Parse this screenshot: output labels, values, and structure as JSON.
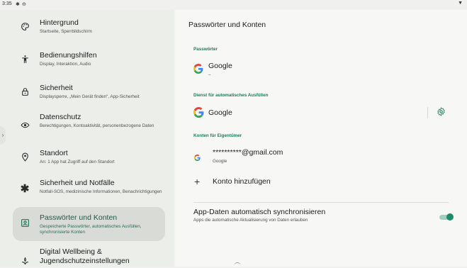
{
  "status": {
    "time": "3:35"
  },
  "sidebar": {
    "items": [
      {
        "title": "Hintergrund",
        "subtitle": "Startseite, Sperrbildschirm"
      },
      {
        "title": "Bedienungshilfen",
        "subtitle": "Display, Interaktion, Audio"
      },
      {
        "title": "Sicherheit",
        "subtitle": "Displaysperre, „Mein Gerät finden“, App-Sicherheit"
      },
      {
        "title": "Datenschutz",
        "subtitle": "Berechtigungen, Kontoaktivität, personenbezogene Daten"
      },
      {
        "title": "Standort",
        "subtitle": "An: 1 App hat Zugriff auf den Standort"
      },
      {
        "title": "Sicherheit und Notfälle",
        "subtitle": "Notfall-SOS, medizinische Informationen, Benachrichtigungen"
      },
      {
        "title": "Passwörter und Konten",
        "subtitle": "Gespeicherte Passwörter, automatisches Ausfüllen, synchronisierte Konten"
      },
      {
        "title": "Digital Wellbeing & Jugendschutzeinstellungen",
        "subtitle": ""
      }
    ]
  },
  "main": {
    "title": "Passwörter und Konten",
    "passwords": {
      "header": "Passwörter",
      "item_label": "Google",
      "item_sub": "–"
    },
    "autofill": {
      "header": "Dienst für automatisches Ausfüllen",
      "item_label": "Google"
    },
    "accounts": {
      "header": "Konten für Eigentümer",
      "account_label": "**********@gmail.com",
      "account_sub": "Google",
      "add_label": "Konto hinzufügen"
    },
    "sync": {
      "title": "App-Daten automatisch synchronisieren",
      "subtitle": "Apps die automatische Aktualisierung von Daten erlauben",
      "enabled": true
    }
  },
  "colors": {
    "accent": "#1d7a5f",
    "active_bg": "#d9dbd6"
  }
}
